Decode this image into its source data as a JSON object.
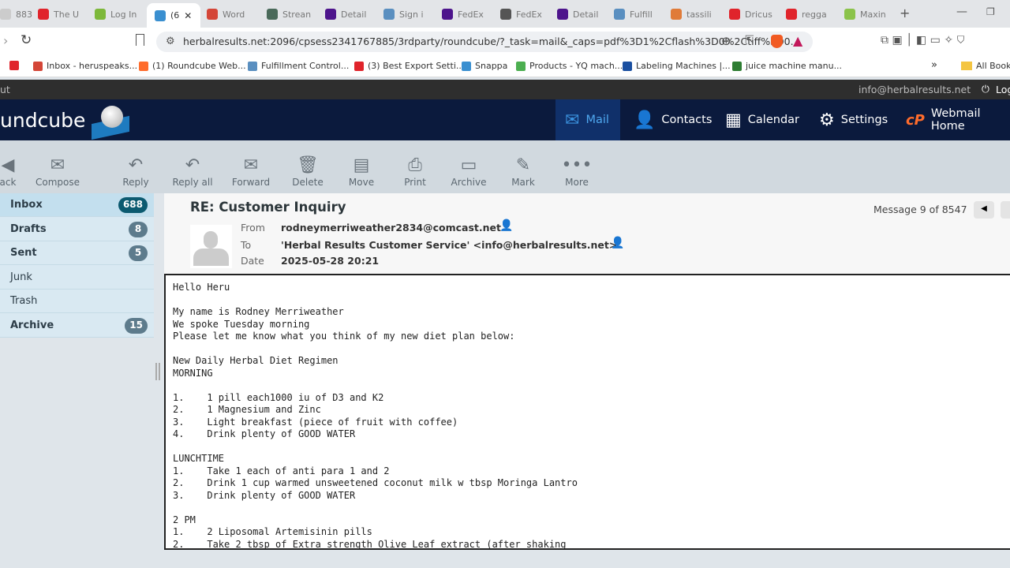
{
  "browser": {
    "tabs": [
      {
        "label": "883",
        "color": "#ccc"
      },
      {
        "label": "The U",
        "color": "#e0242b"
      },
      {
        "label": "Log In",
        "color": "#7db83a"
      },
      {
        "label": "(6",
        "color": "#3a8fd0",
        "active": true
      },
      {
        "label": "Word",
        "color": "#d44638"
      },
      {
        "label": "Strean",
        "color": "#4a6a5a"
      },
      {
        "label": "Detail",
        "color": "#4d148c"
      },
      {
        "label": "Sign i",
        "color": "#5a8fc0"
      },
      {
        "label": "FedEx",
        "color": "#4d148c"
      },
      {
        "label": "FedEx",
        "color": "#555"
      },
      {
        "label": "Detail",
        "color": "#4d148c"
      },
      {
        "label": "Fulfill",
        "color": "#5a8fc0"
      },
      {
        "label": "tassili",
        "color": "#e07b39"
      },
      {
        "label": "Dricus",
        "color": "#e0242b"
      },
      {
        "label": "regga",
        "color": "#e0242b"
      },
      {
        "label": "Maxin",
        "color": "#8bc34a"
      }
    ],
    "url": "herbalresults.net:2096/cpsess2341767885/3rdparty/roundcube/?_task=mail&_caps=pdf%3D1%2Cflash%3D0%2Ctiff%3D0...",
    "bookmarks": [
      {
        "label": "",
        "color": "#e0242b"
      },
      {
        "label": "Inbox - heruspeaks...",
        "color": "#d44638"
      },
      {
        "label": "(1) Roundcube Web...",
        "color": "#ff6c2c"
      },
      {
        "label": "Fulfillment Control...",
        "color": "#5a8fc0"
      },
      {
        "label": "(3) Best Export Setti...",
        "color": "#e0242b"
      },
      {
        "label": "Snappa",
        "color": "#3a8fd0"
      },
      {
        "label": "Products - YQ mach...",
        "color": "#4caf50"
      },
      {
        "label": "Labeling Machines |...",
        "color": "#1a4fa0"
      },
      {
        "label": "juice machine manu...",
        "color": "#2e7d32"
      }
    ],
    "more_bookmarks": "»",
    "all_bookmarks": "All Bookm"
  },
  "topline": {
    "left": "ut",
    "user": "info@herbalresults.net",
    "logout": "Log"
  },
  "logo": "undcube",
  "nav": [
    {
      "label": "Mail",
      "icon": "mail-icon",
      "active": true
    },
    {
      "label": "Contacts",
      "icon": "contacts-icon"
    },
    {
      "label": "Calendar",
      "icon": "calendar-icon"
    },
    {
      "label": "Settings",
      "icon": "gear-icon"
    },
    {
      "label": "Webmail Home",
      "icon": "cpanel-icon"
    }
  ],
  "toolbar": [
    "ack",
    "Compose",
    "Reply",
    "Reply all",
    "Forward",
    "Delete",
    "Move",
    "Print",
    "Archive",
    "Mark",
    "More"
  ],
  "folders": [
    {
      "label": "Inbox",
      "count": "688"
    },
    {
      "label": "Drafts",
      "count": "8"
    },
    {
      "label": "Sent",
      "count": "5"
    },
    {
      "label": "Junk",
      "count": ""
    },
    {
      "label": "Trash",
      "count": ""
    },
    {
      "label": "Archive",
      "count": "15"
    }
  ],
  "message": {
    "subject": "RE: Customer Inquiry",
    "counter": "Message 9 of 8547",
    "from_label": "From",
    "from": "rodneymerriweather2834@comcast.net",
    "to_label": "To",
    "to": "'Herbal Results Customer Service' <info@herbalresults.net>",
    "date_label": "Date",
    "date": "2025-05-28 20:21",
    "body": "Hello Heru\n\nMy name is Rodney Merriweather\nWe spoke Tuesday morning\nPlease let me know what you think of my new diet plan below:\n\nNew Daily Herbal Diet Regimen\nMORNING\n\n1.    1 pill each1000 iu of D3 and K2\n2.    1 Magnesium and Zinc\n3.    Light breakfast (piece of fruit with coffee)\n4.    Drink plenty of GOOD WATER\n\nLUNCHTIME\n1.    Take 1 each of anti para 1 and 2\n2.    Drink 1 cup warmed unsweetened coconut milk w tbsp Moringa Lantro\n3.    Drink plenty of GOOD WATER\n\n2 PM\n1.    2 Liposomal Artemisinin pills\n2.    Take 2 tbsp of Extra strength Olive Leaf extract (after shaking"
  }
}
